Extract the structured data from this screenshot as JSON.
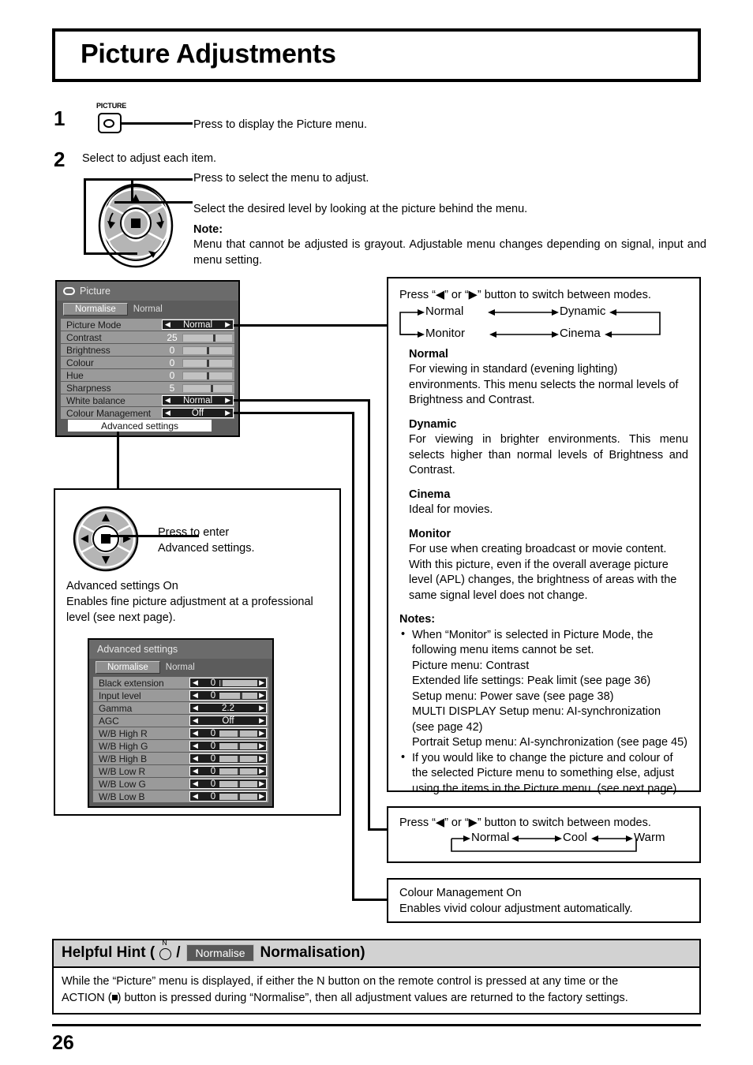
{
  "page": {
    "title": "Picture Adjustments",
    "number": "26"
  },
  "steps": [
    {
      "num": "1",
      "key_label": "PICTURE",
      "text": "Press to display the Picture menu."
    },
    {
      "num": "2",
      "heading": "Select to adjust each item.",
      "line1": "Press to select the menu to adjust.",
      "line2": "Select the desired level by looking at the picture behind the menu.",
      "note_title": "Note:",
      "note_text": "Menu that cannot be adjusted is grayout. Adjustable menu changes depending on signal, input and menu setting."
    }
  ],
  "picture_osd": {
    "title": "Picture",
    "normalise_button": "Normalise",
    "normalise_value": "Normal",
    "rows": [
      {
        "label": "Picture Mode",
        "type": "select",
        "value": "Normal"
      },
      {
        "label": "Contrast",
        "type": "slider",
        "value": "25",
        "knob_pct": 62
      },
      {
        "label": "Brightness",
        "type": "slider",
        "value": "0",
        "knob_pct": 48
      },
      {
        "label": "Colour",
        "type": "slider",
        "value": "0",
        "knob_pct": 48
      },
      {
        "label": "Hue",
        "type": "slider",
        "value": "0",
        "knob_pct": 48
      },
      {
        "label": "Sharpness",
        "type": "slider",
        "value": "5",
        "knob_pct": 56
      },
      {
        "label": "White balance",
        "type": "select",
        "value": "Normal"
      },
      {
        "label": "Colour Management",
        "type": "select",
        "value": "Off"
      }
    ],
    "advanced_button": "Advanced settings"
  },
  "advanced_osd": {
    "title": "Advanced settings",
    "normalise_button": "Normalise",
    "normalise_value": "Normal",
    "rows": [
      {
        "label": "Black extension",
        "type": "slider",
        "value": "0",
        "knob_pct": 3
      },
      {
        "label": "Input level",
        "type": "slider",
        "value": "0",
        "knob_pct": 55
      },
      {
        "label": "Gamma",
        "type": "text",
        "value": "2.2"
      },
      {
        "label": "AGC",
        "type": "text",
        "value": "Off"
      },
      {
        "label": "W/B High R",
        "type": "slider",
        "value": "0",
        "knob_pct": 48
      },
      {
        "label": "W/B High G",
        "type": "slider",
        "value": "0",
        "knob_pct": 48
      },
      {
        "label": "W/B High B",
        "type": "slider",
        "value": "0",
        "knob_pct": 48
      },
      {
        "label": "W/B Low R",
        "type": "slider",
        "value": "0",
        "knob_pct": 48
      },
      {
        "label": "W/B Low G",
        "type": "slider",
        "value": "0",
        "knob_pct": 48
      },
      {
        "label": "W/B Low B",
        "type": "slider",
        "value": "0",
        "knob_pct": 48
      }
    ]
  },
  "advanced_box": {
    "dpad_text_line1": "Press to enter",
    "dpad_text_line2": "Advanced settings.",
    "desc_line1": "Advanced settings On",
    "desc_line2": "Enables fine picture adjustment at a professional",
    "desc_line3": "level (see next page)."
  },
  "picture_mode_box": {
    "intro": "Press “◀” or “▶” button to switch between modes.",
    "cycle": [
      "Normal",
      "Dynamic",
      "Monitor",
      "Cinema"
    ],
    "modes": [
      {
        "name": "Normal",
        "desc": "For viewing in standard (evening lighting) environments. This menu selects the normal levels of Brightness and Contrast."
      },
      {
        "name": "Dynamic",
        "desc": "For viewing in brighter environments. This menu selects higher than normal levels of Brightness and Contrast."
      },
      {
        "name": "Cinema",
        "desc": "Ideal for movies."
      },
      {
        "name": "Monitor",
        "desc": "For use when creating broadcast or movie content. With this picture, even if the overall average picture level (APL) changes, the brightness of areas with the same signal level does not change."
      }
    ],
    "notes_title": "Notes:",
    "note1_lines": [
      "When “Monitor” is selected in Picture Mode, the",
      "following menu items cannot be set.",
      "Picture menu: Contrast",
      "Extended life settings: Peak limit (see page 36)",
      "Setup menu: Power save (see page 38)",
      "MULTI DISPLAY Setup menu: AI-synchronization",
      "(see page 42)",
      "Portrait Setup menu: AI-synchronization (see page 45)"
    ],
    "note2_lines": [
      "If you would like to change the picture and colour of",
      "the selected Picture menu to something else, adjust",
      "using the items in the Picture menu. (see next page)"
    ]
  },
  "white_balance_box": {
    "intro": "Press “◀” or “▶” button to switch between modes.",
    "cycle": [
      "Normal",
      "Cool",
      "Warm"
    ]
  },
  "colour_management_box": {
    "line1": "Colour Management On",
    "line2": "Enables vivid colour adjustment automatically."
  },
  "helpful_hint": {
    "prefix": "Helpful Hint (",
    "n_label": "N",
    "slash": "/",
    "chip": "Normalise",
    "suffix": "Normalisation)",
    "body_line1": "While the “Picture” menu is displayed, if either the N button on the remote control is pressed at any time or the",
    "body_line2_a": "ACTION (",
    "body_line2_b": ") button is pressed during “Normalise”, then all adjustment values are returned to the factory settings."
  }
}
